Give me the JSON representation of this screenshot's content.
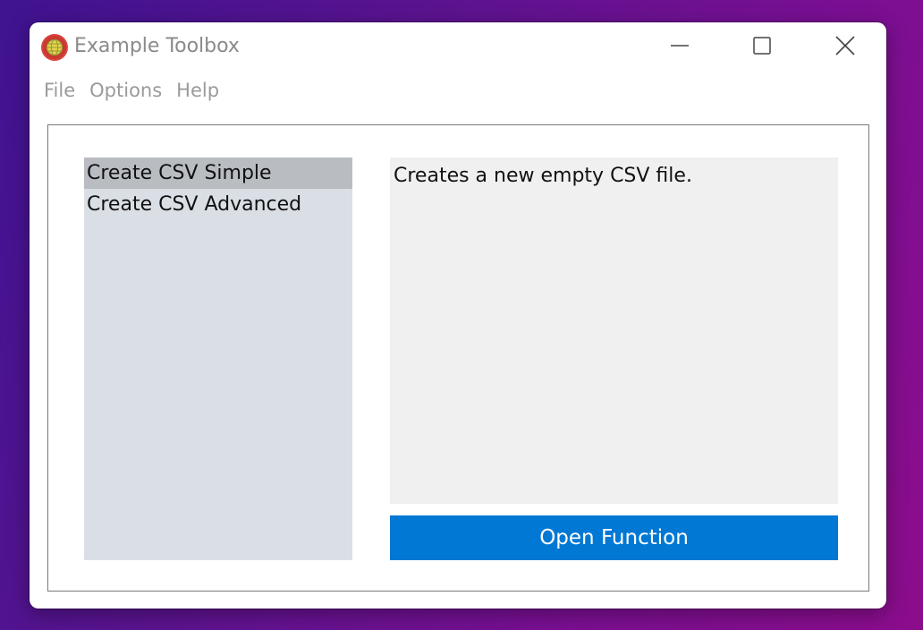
{
  "window": {
    "title": "Example Toolbox",
    "app_icon": "globe-icon",
    "controls": {
      "minimize": "minimize-icon",
      "maximize": "maximize-icon",
      "close": "close-icon"
    }
  },
  "menu": {
    "items": [
      {
        "label": "File"
      },
      {
        "label": "Options"
      },
      {
        "label": "Help"
      }
    ]
  },
  "functions": {
    "items": [
      {
        "label": "Create CSV Simple",
        "selected": true
      },
      {
        "label": "Create CSV Advanced",
        "selected": false
      }
    ]
  },
  "description": {
    "text": "Creates a new empty CSV file."
  },
  "actions": {
    "open_label": "Open Function"
  },
  "colors": {
    "accent": "#0078d4",
    "list_background": "#dadfe6",
    "list_selected": "#b9bdc2",
    "description_background": "#f0f0f0",
    "app_icon_red": "#d9453d",
    "app_icon_yellow": "#e8d24a"
  }
}
